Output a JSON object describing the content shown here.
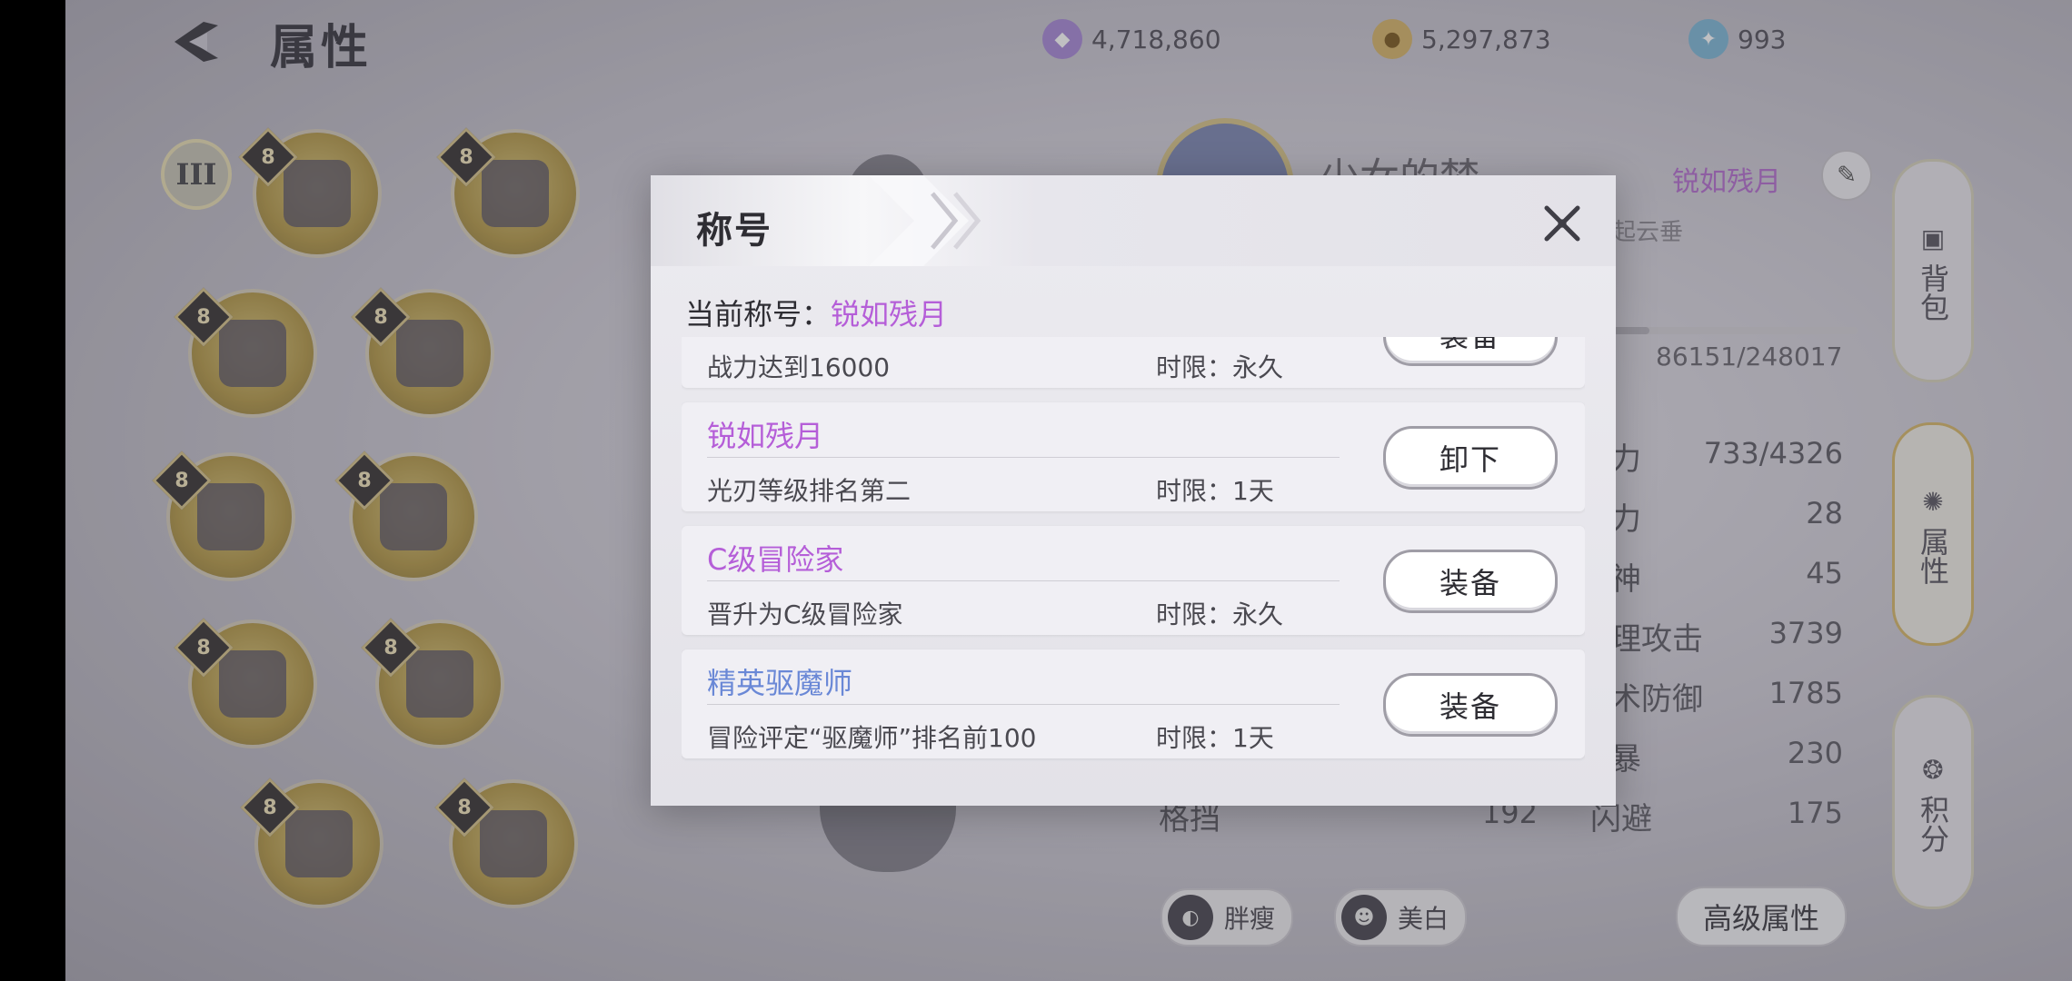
{
  "header": {
    "title": "属性"
  },
  "currencies": [
    {
      "icon": "crystal-icon",
      "value": "4,718,860"
    },
    {
      "icon": "gold-coin-icon",
      "value": "5,297,873"
    },
    {
      "icon": "spirit-icon",
      "value": "993"
    }
  ],
  "equipment": {
    "tier": "III",
    "level": "8"
  },
  "character": {
    "name": "少女的梦",
    "title": "锐如残月",
    "guild": "：缘起云垂",
    "exp": "86151/248017"
  },
  "stats": [
    {
      "label": "力",
      "value": "733/4326"
    },
    {
      "label": "力",
      "value": "28"
    },
    {
      "label": "神",
      "value": "45"
    },
    {
      "label": "理攻击",
      "value": "3739"
    },
    {
      "label": "术防御",
      "value": "1785"
    },
    {
      "label": "暴",
      "value": "230"
    },
    {
      "label": "闪避",
      "value": "175"
    }
  ],
  "left_stat": {
    "label": "格挡",
    "value": "192"
  },
  "bottom": {
    "body_shape": "胖瘦",
    "whiten": "美白",
    "advanced": "高级属性"
  },
  "side_tabs": {
    "bag": "背包",
    "attributes": "属性",
    "points": "积分"
  },
  "modal": {
    "title": "称号",
    "current_label": "当前称号：",
    "current_value": "锐如残月",
    "items": [
      {
        "name": "",
        "desc": "战力达到16000",
        "limit": "时限：永久",
        "button": "装备"
      },
      {
        "name": "锐如残月",
        "desc": "光刃等级排名第二",
        "limit": "时限：1天",
        "button": "卸下",
        "color": "#b55ed8"
      },
      {
        "name": "C级冒险家",
        "desc": "晋升为C级冒险家",
        "limit": "时限：永久",
        "button": "装备",
        "color": "#b55ed8"
      },
      {
        "name": "精英驱魔师",
        "desc": "冒险评定“驱魔师”排名前100",
        "limit": "时限：1天",
        "button": "装备",
        "color": "#6a88d6"
      }
    ]
  },
  "colors": {
    "accent_purple": "#b55ed8",
    "accent_blue": "#6a88d6"
  }
}
